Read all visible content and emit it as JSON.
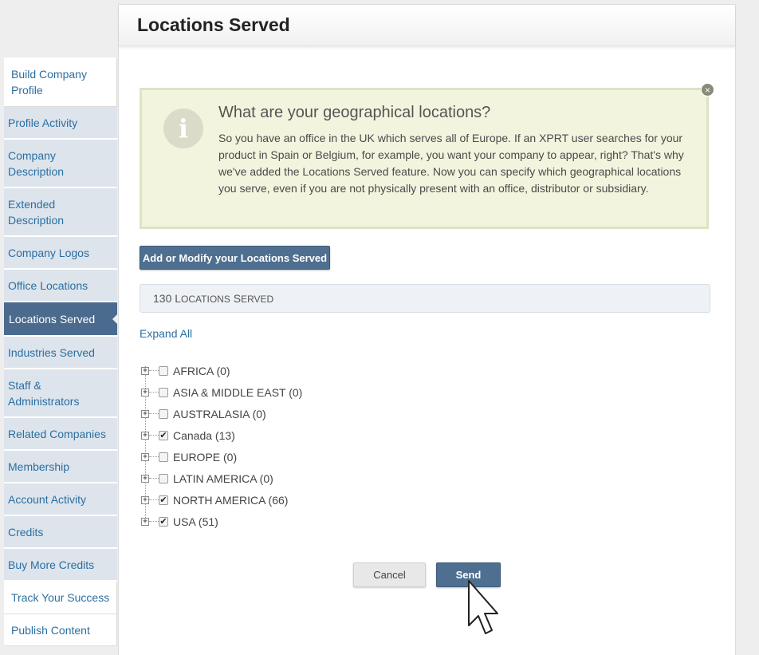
{
  "sidebar": {
    "items": [
      {
        "label": "Build Company Profile",
        "style": "white"
      },
      {
        "label": "Profile Activity"
      },
      {
        "label": "Company Description"
      },
      {
        "label": "Extended Description"
      },
      {
        "label": "Company Logos"
      },
      {
        "label": "Office Locations"
      },
      {
        "label": "Locations Served",
        "active": true
      },
      {
        "label": "Industries Served"
      },
      {
        "label": "Staff & Administrators"
      },
      {
        "label": "Related Companies"
      },
      {
        "label": "Membership"
      },
      {
        "label": "Account Activity"
      },
      {
        "label": "Credits"
      },
      {
        "label": "Buy More Credits"
      },
      {
        "label": "Track Your Success",
        "style": "white"
      },
      {
        "label": "Publish Content",
        "style": "white"
      }
    ]
  },
  "main": {
    "title": "Locations Served",
    "info": {
      "icon_glyph": "i",
      "close_glyph": "×",
      "heading": "What are your geographical locations?",
      "text": "So you have an office in the UK which serves all of Europe. If an XPRT user searches for your product in Spain or Belgium, for example, you want your company to appear, right? That's why we've added the Locations Served feature. Now you can specify which geographical locations you serve, even if you are not physically present with an office, distributor or subsidiary."
    },
    "add_button_label": "Add or Modify your Locations Served",
    "count": {
      "number": "130",
      "label_first": "L",
      "label_first_rest": "OCATIONS",
      "label_second": "S",
      "label_second_rest": "ERVED"
    },
    "expand_all_label": "Expand All",
    "tree": [
      {
        "label": "AFRICA (0)",
        "checked": false
      },
      {
        "label": "ASIA & MIDDLE EAST (0)",
        "checked": false
      },
      {
        "label": "AUSTRALASIA (0)",
        "checked": false
      },
      {
        "label": "Canada (13)",
        "checked": true
      },
      {
        "label": "EUROPE (0)",
        "checked": false
      },
      {
        "label": "LATIN AMERICA (0)",
        "checked": false
      },
      {
        "label": "NORTH AMERICA (66)",
        "checked": true
      },
      {
        "label": "USA (51)",
        "checked": true
      }
    ],
    "expand_glyph": "+",
    "check_glyph": "✔",
    "cancel_label": "Cancel",
    "send_label": "Send"
  },
  "colors": {
    "sidebar_bg": "#dde4ec",
    "sidebar_active": "#4a6b8d",
    "link": "#2a6fa1",
    "primary_button": "#4f6f90",
    "info_bg": "#f3f4de"
  }
}
